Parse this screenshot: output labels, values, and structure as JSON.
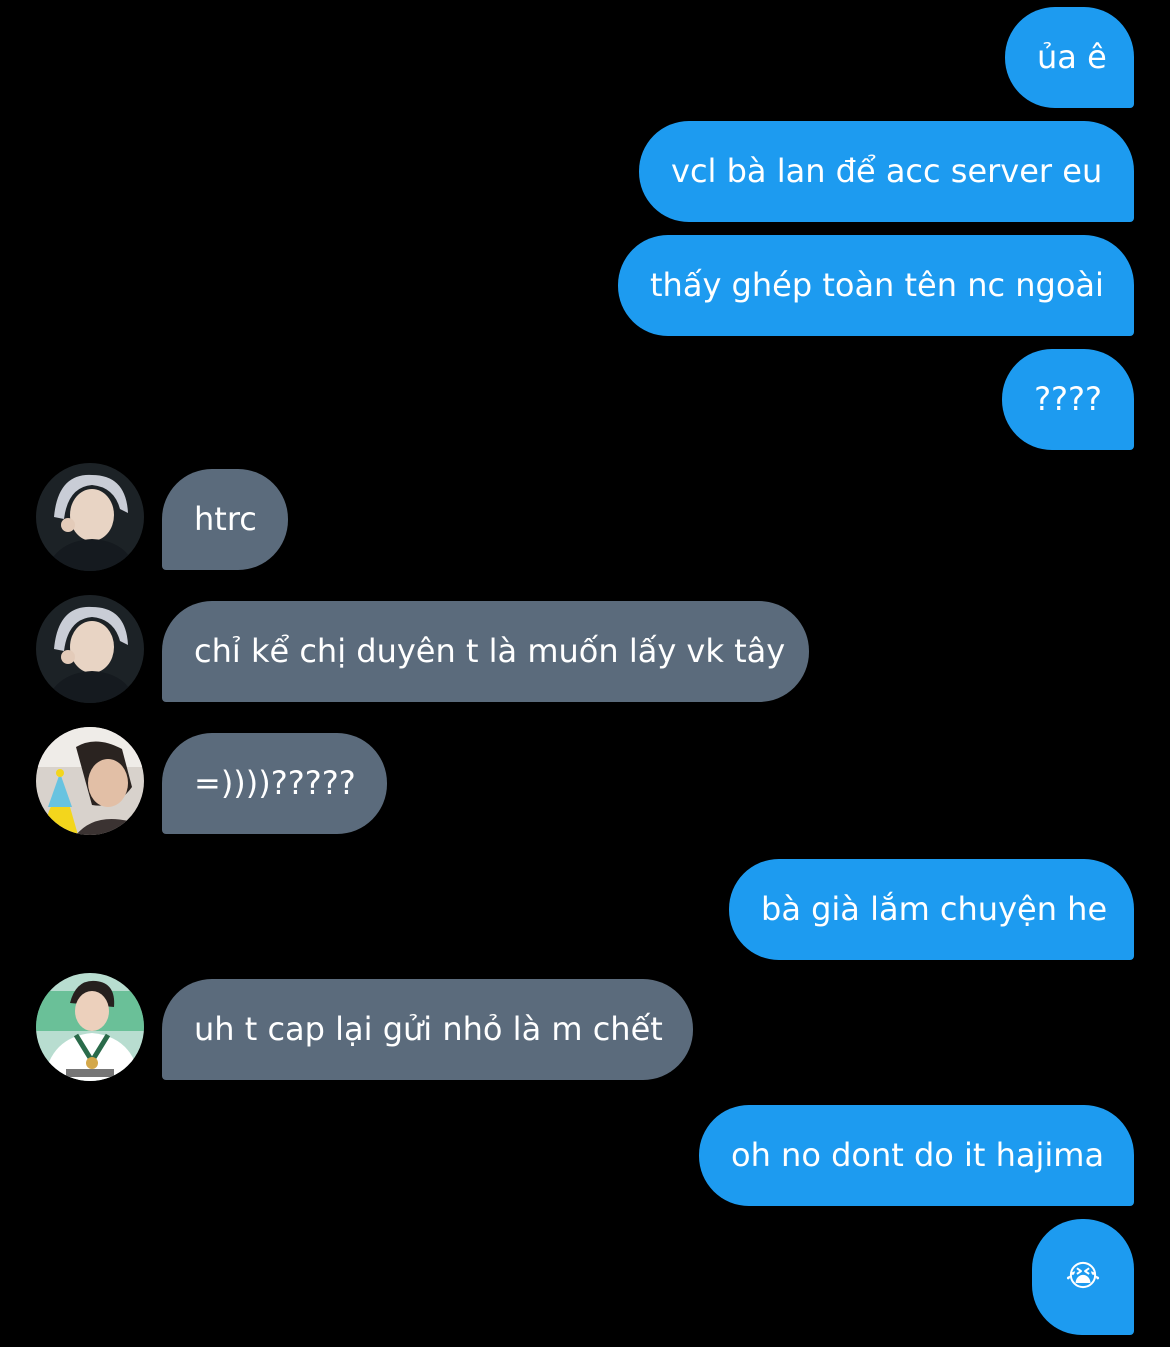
{
  "colors": {
    "background": "#000000",
    "sent_bubble": "#1d9bf0",
    "received_bubble": "#5b6b7c",
    "text": "#ffffff"
  },
  "messages": [
    {
      "direction": "sent",
      "text": "ủa ê"
    },
    {
      "direction": "sent",
      "text": "vcl bà lan để acc server eu"
    },
    {
      "direction": "sent",
      "text": "thấy ghép toàn tên nc ngoài"
    },
    {
      "direction": "sent",
      "text": "????"
    },
    {
      "direction": "received",
      "avatar": "avatar-silver-hair",
      "text": "htrc"
    },
    {
      "direction": "received",
      "avatar": "avatar-silver-hair",
      "text": "chỉ kể chị duyên t là muốn lấy vk tây"
    },
    {
      "direction": "received",
      "avatar": "avatar-party-hat",
      "text": "=))))?????"
    },
    {
      "direction": "sent",
      "text": "bà già lắm chuyện he"
    },
    {
      "direction": "received",
      "avatar": "avatar-medal",
      "text": "uh t cap lại gửi nhỏ là m chết"
    },
    {
      "direction": "sent",
      "text": "oh no dont do it hajima"
    },
    {
      "direction": "sent",
      "text": "😭",
      "icon": "loudly-crying-face-emoji"
    }
  ]
}
